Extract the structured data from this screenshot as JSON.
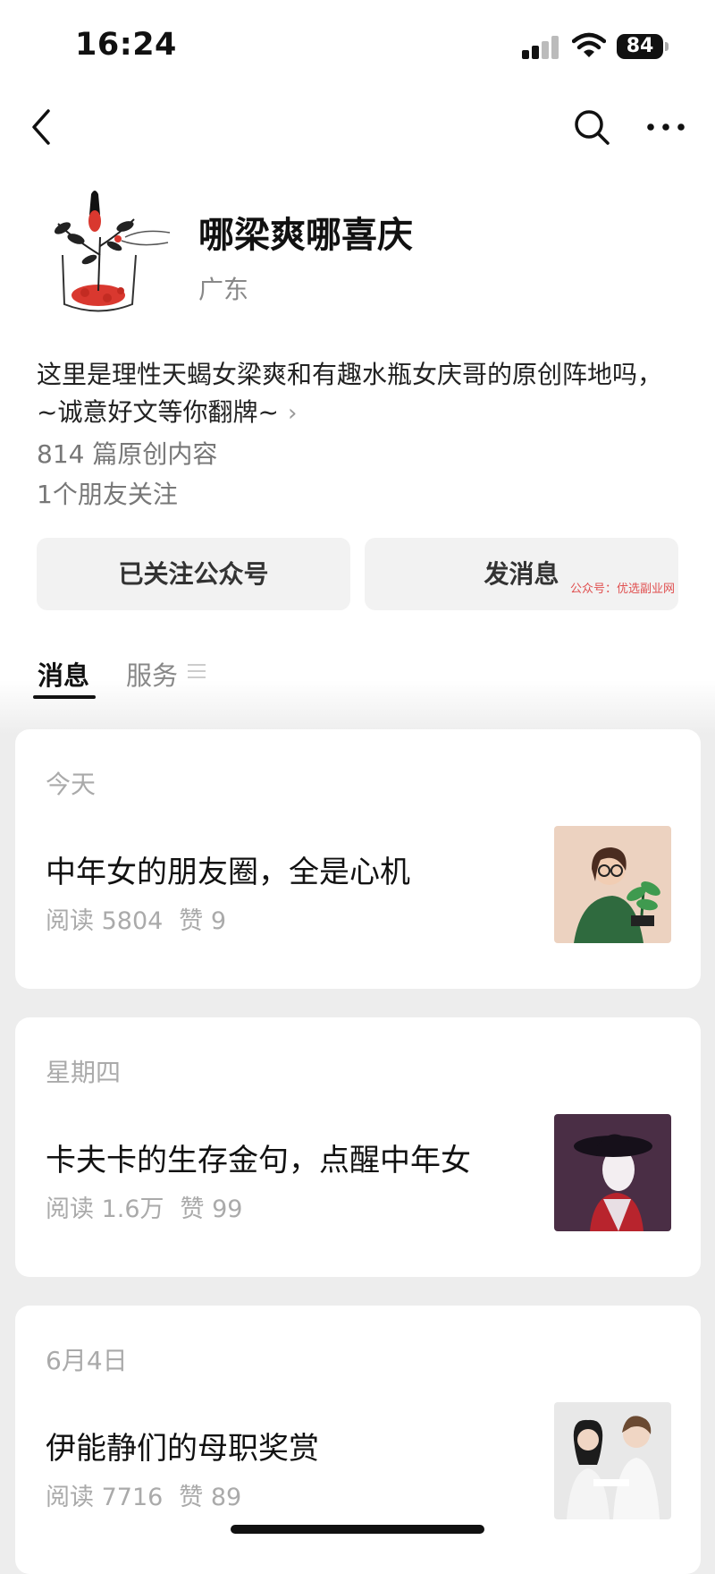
{
  "status_bar": {
    "time": "16:24",
    "battery": "84"
  },
  "account": {
    "name": "哪梁爽哪喜庆",
    "region": "广东",
    "bio": "这里是理性天蝎女梁爽和有趣水瓶女庆哥的原创阵地吗，~诚意好文等你翻牌~",
    "article_count": "814 篇原创内容",
    "friends_following": "1个朋友关注"
  },
  "actions": {
    "follow_label": "已关注公众号",
    "message_label": "发消息"
  },
  "watermark": "公众号：优选副业网",
  "tabs": [
    {
      "label": "消息"
    },
    {
      "label": "服务"
    }
  ],
  "articles": [
    {
      "date": "今天",
      "title": "中年女的朋友圈，全是心机",
      "reads": "阅读 5804",
      "likes": "赞 9"
    },
    {
      "date": "星期四",
      "title": "卡夫卡的生存金句，点醒中年女",
      "reads": "阅读 1.6万",
      "likes": "赞 99"
    },
    {
      "date": "6月4日",
      "title": "伊能静们的母职奖赏",
      "reads": "阅读 7716",
      "likes": "赞 89"
    }
  ],
  "icons": [
    "back-icon",
    "search-icon",
    "more-icon",
    "signal-icon",
    "wifi-icon",
    "battery-icon",
    "menu-icon"
  ],
  "colors": {
    "background": "#ededed",
    "card": "#ffffff",
    "button": "#f2f2f2",
    "watermark": "#e05050"
  }
}
